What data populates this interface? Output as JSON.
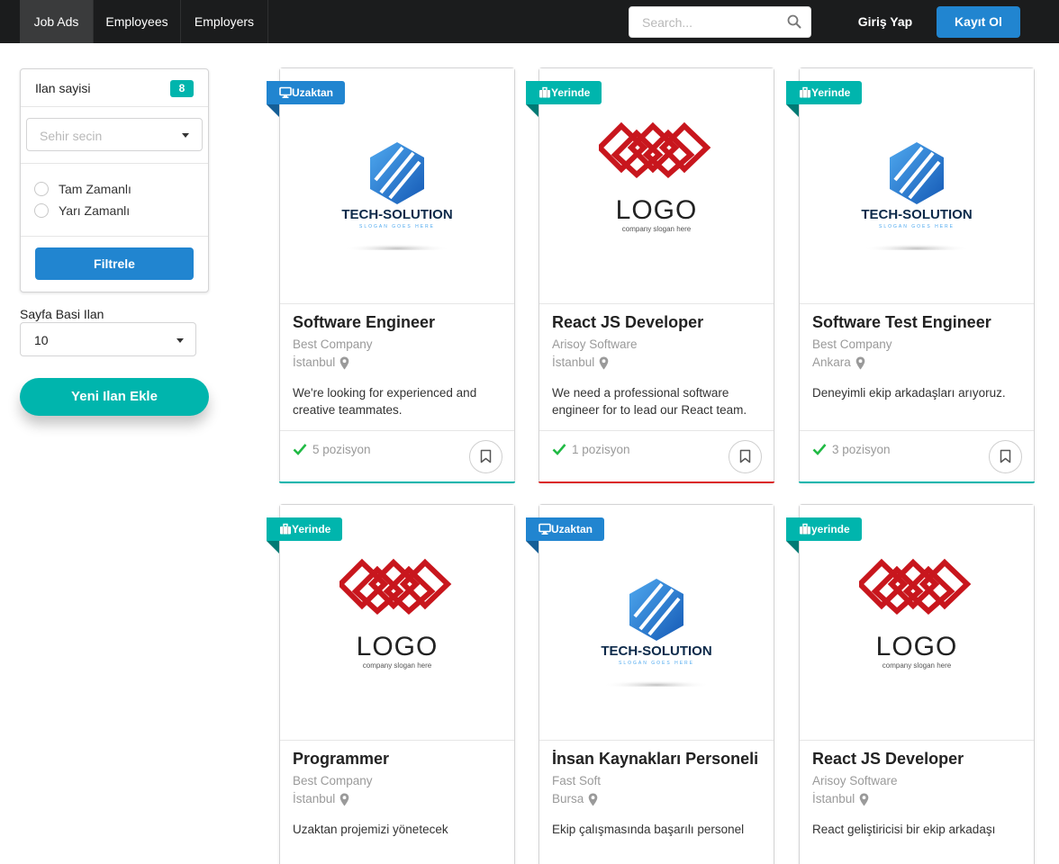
{
  "nav": {
    "items": [
      {
        "label": "Job Ads",
        "active": true
      },
      {
        "label": "Employees",
        "active": false
      },
      {
        "label": "Employers",
        "active": false
      }
    ],
    "search_placeholder": "Search...",
    "login_label": "Giriş Yap",
    "signup_label": "Kayıt Ol"
  },
  "sidebar": {
    "count_label": "Ilan sayisi",
    "count_value": "8",
    "city_placeholder": "Sehir secin",
    "work_types": [
      "Tam Zamanlı",
      "Yarı Zamanlı"
    ],
    "filter_button": "Filtrele",
    "per_page_label": "Sayfa Basi Ilan",
    "per_page_value": "10",
    "add_button": "Yeni Ilan Ekle"
  },
  "colors": {
    "blue": "#2185d0",
    "teal": "#00b5ad",
    "red": "#db2828",
    "logo_red": "#c8161d",
    "check_green": "#21ba45"
  },
  "cards": [
    {
      "ribbon": "Uzaktan",
      "ribbon_icon": "desktop-icon",
      "ribbon_color": "blue",
      "logo": "tech-solution",
      "title": "Software Engineer",
      "company": "Best Company",
      "city": "İstanbul",
      "description": "We're looking for experienced and creative teammates.",
      "positions": "5 pozisyon",
      "accent": "teal"
    },
    {
      "ribbon": "Yerinde",
      "ribbon_icon": "briefcase-icon",
      "ribbon_color": "teal",
      "logo": "logo-red",
      "title": "React JS Developer",
      "company": "Arisoy Software",
      "city": "İstanbul",
      "description": "We need a professional software engineer for to lead our React team.",
      "positions": "1 pozisyon",
      "accent": "red"
    },
    {
      "ribbon": "Yerinde",
      "ribbon_icon": "briefcase-icon",
      "ribbon_color": "teal",
      "logo": "tech-solution",
      "title": "Software Test Engineer",
      "company": "Best Company",
      "city": "Ankara",
      "description": "Deneyimli ekip arkadaşları arıyoruz.",
      "positions": "3 pozisyon",
      "accent": "teal"
    },
    {
      "ribbon": "Yerinde",
      "ribbon_icon": "briefcase-icon",
      "ribbon_color": "teal",
      "logo": "logo-red",
      "title": "Programmer",
      "company": "Best Company",
      "city": "İstanbul",
      "description": "Uzaktan projemizi yönetecek",
      "positions": "",
      "accent": ""
    },
    {
      "ribbon": "Uzaktan",
      "ribbon_icon": "desktop-icon",
      "ribbon_color": "blue",
      "logo": "tech-solution",
      "title": "İnsan Kaynakları Personeli",
      "company": "Fast Soft",
      "city": "Bursa",
      "description": "Ekip çalışmasında başarılı personel",
      "positions": "",
      "accent": ""
    },
    {
      "ribbon": "yerinde",
      "ribbon_icon": "briefcase-icon",
      "ribbon_color": "teal",
      "logo": "logo-red",
      "title": "React JS Developer",
      "company": "Arisoy Software",
      "city": "İstanbul",
      "description": "React geliştiricisi bir ekip arkadaşı",
      "positions": "",
      "accent": ""
    }
  ],
  "logos": {
    "tech": {
      "name": "TECH-SOLUTION",
      "slogan": "SLOGAN GOES HERE"
    },
    "red": {
      "name": "LOGO",
      "slogan": "company slogan here"
    }
  }
}
